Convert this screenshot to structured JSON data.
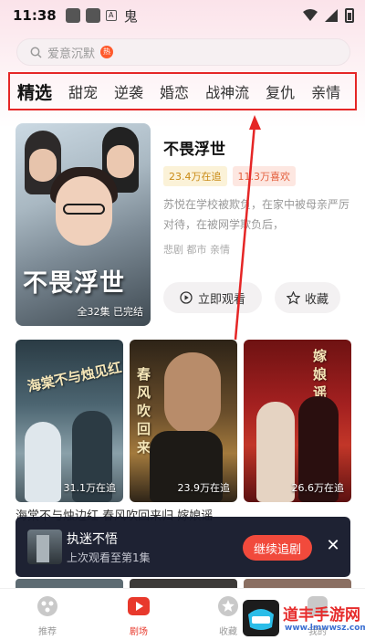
{
  "status_bar": {
    "time": "11:38",
    "carrier_glyph": "鬼"
  },
  "search": {
    "placeholder": "爱意沉默",
    "hot_badge": "热"
  },
  "tabs": [
    "精选",
    "甜宠",
    "逆袭",
    "婚恋",
    "战神流",
    "复仇",
    "亲情"
  ],
  "featured": {
    "poster_title": "不畏浮世",
    "poster_meta": "全32集  已完结",
    "title": "不畏浮世",
    "watching": "23.4万在追",
    "likes": "11.3万喜欢",
    "description": "苏悦在学校被欺负，在家中被母亲严厉对待，在被网学欺负后，",
    "tags": "悲剧 都市 亲情",
    "watch_label": "立即观看",
    "fav_label": "收藏"
  },
  "cards": [
    {
      "title_art": "海棠不与烛见红",
      "count": "31.1万在追"
    },
    {
      "title_art": "春风吹回来",
      "count": "23.9万在追"
    },
    {
      "title_art": "嫁娘谣",
      "count": "26.6万在追"
    }
  ],
  "row_caption": "海棠不与烛边红    春风吹回来归    嫁娘谣",
  "toast": {
    "title": "执迷不悟",
    "subtitle": "上次观看至第1集",
    "continue_label": "继续追剧",
    "close_glyph": "✕"
  },
  "nav": [
    {
      "label": "推荐",
      "icon": "recommend-icon",
      "active": false
    },
    {
      "label": "剧场",
      "icon": "theater-icon",
      "active": true
    },
    {
      "label": "收藏",
      "icon": "star-icon",
      "active": false
    },
    {
      "label": "我的",
      "icon": "profile-icon",
      "active": false
    }
  ],
  "watermark": {
    "brand": "道丰手游网",
    "url": "www.lmwwsz.com"
  },
  "colors": {
    "accent": "#e8392c",
    "highlight_box": "#e52626",
    "toast_bg": "#121628"
  }
}
